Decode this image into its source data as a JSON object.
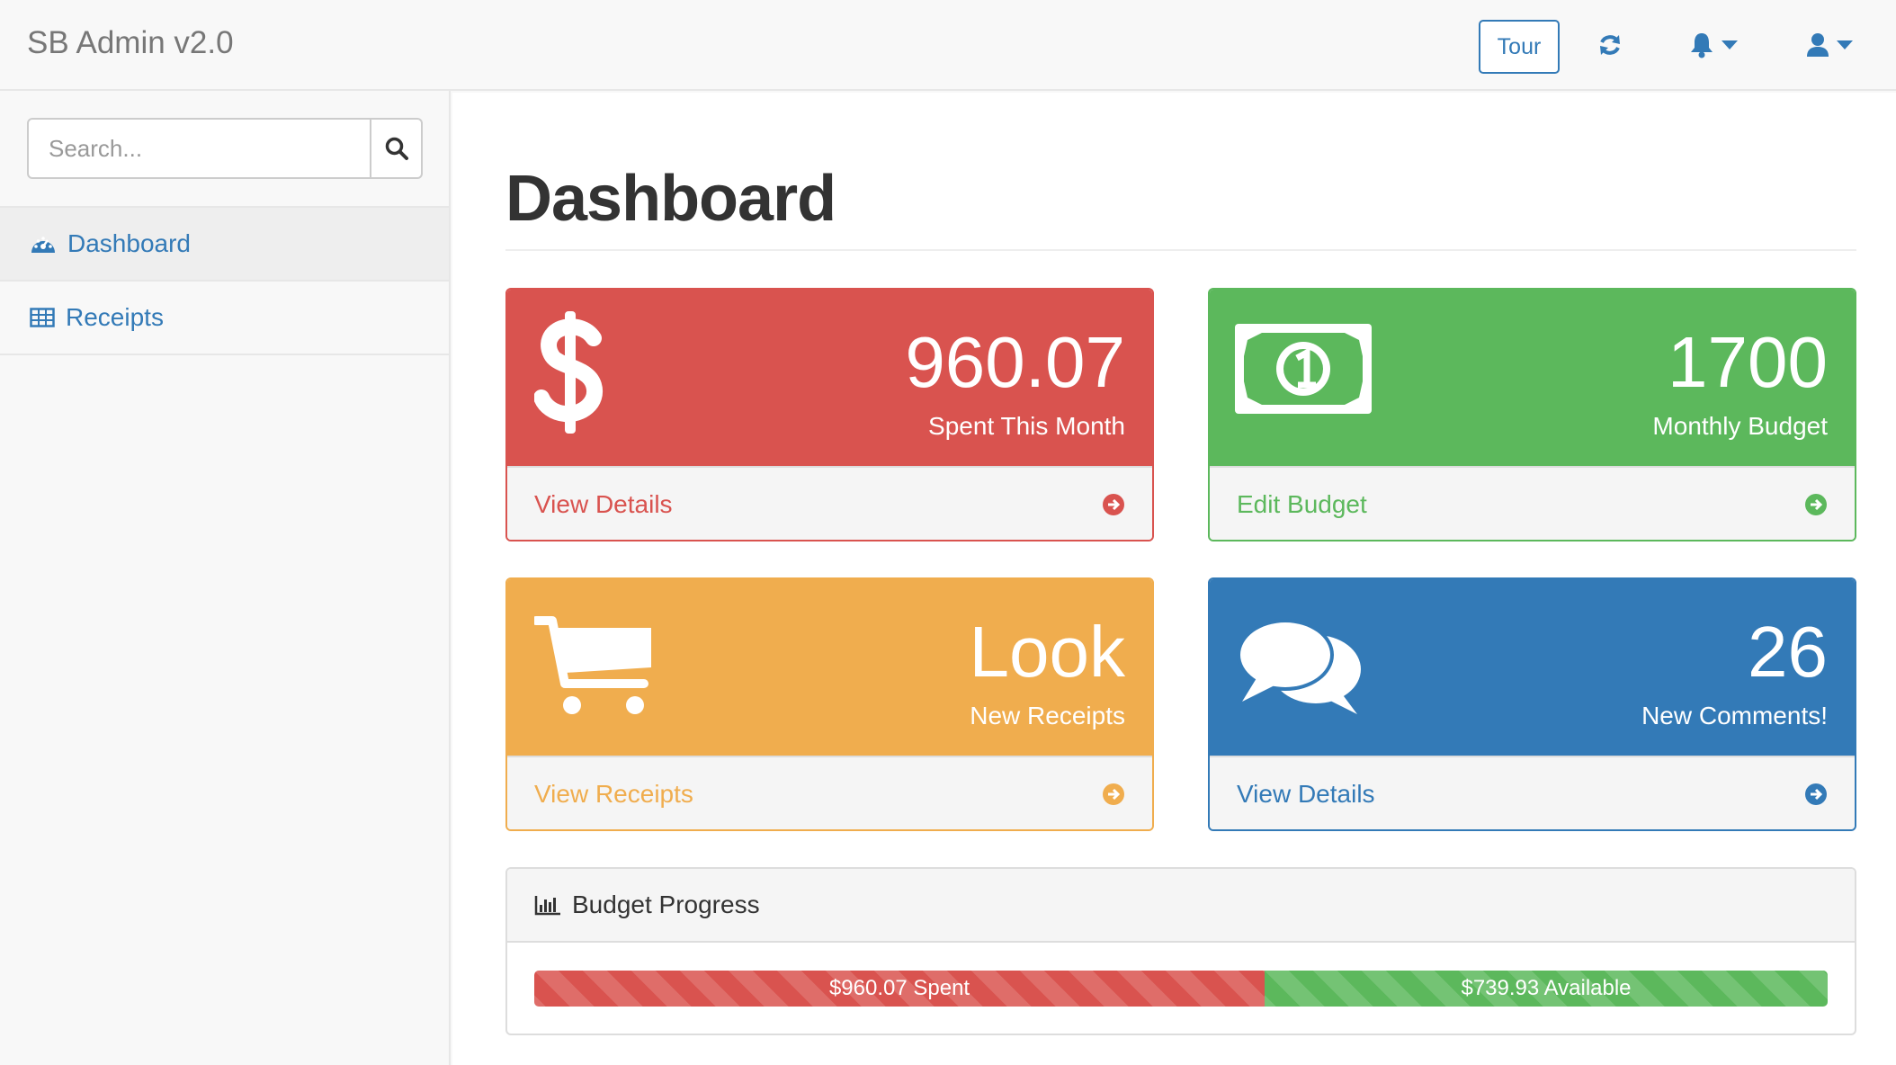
{
  "app": {
    "brand": "SB Admin v2.0"
  },
  "navbar": {
    "tour_label": "Tour",
    "icons": [
      "refresh-icon",
      "bell-icon",
      "user-icon"
    ]
  },
  "sidebar": {
    "search_placeholder": "Search...",
    "items": [
      {
        "label": "Dashboard",
        "icon": "dashboard-icon",
        "active": true
      },
      {
        "label": "Receipts",
        "icon": "table-icon",
        "active": false
      }
    ]
  },
  "main": {
    "title": "Dashboard",
    "panels": [
      {
        "value": "960.07",
        "label": "Spent This Month",
        "footer": "View Details",
        "color": "#d9534f",
        "icon": "dollar-icon"
      },
      {
        "value": "1700",
        "label": "Monthly Budget",
        "footer": "Edit Budget",
        "color": "#5cb85c",
        "icon": "money-icon"
      },
      {
        "value": "Look",
        "label": "New Receipts",
        "footer": "View Receipts",
        "color": "#f0ad4e",
        "icon": "cart-icon"
      },
      {
        "value": "26",
        "label": "New Comments!",
        "footer": "View Details",
        "color": "#337ab7",
        "icon": "comments-icon"
      }
    ],
    "budget_progress": {
      "title": "Budget Progress",
      "spent_label": "$960.07 Spent",
      "available_label": "$739.93 Available",
      "spent_fraction": 0.5647,
      "spent_color": "#d9534f",
      "available_color": "#5cb85c"
    }
  }
}
